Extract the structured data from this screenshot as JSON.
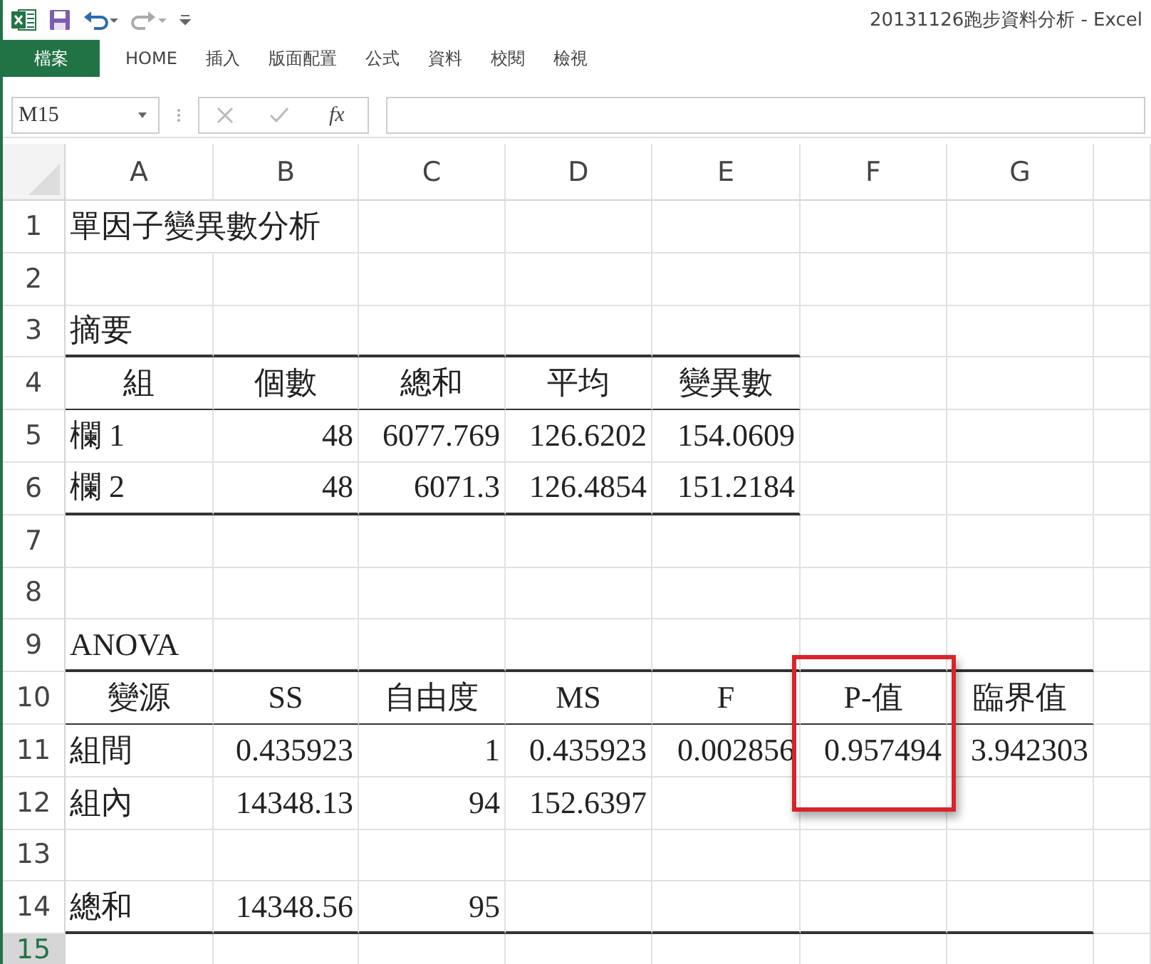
{
  "window": {
    "title": "20131126跑步資料分析 - Excel"
  },
  "ribbon_tabs": [
    {
      "label": "檔案",
      "selected": true
    },
    {
      "label": "HOME",
      "selected": false
    },
    {
      "label": "插入",
      "selected": false
    },
    {
      "label": "版面配置",
      "selected": false
    },
    {
      "label": "公式",
      "selected": false
    },
    {
      "label": "資料",
      "selected": false
    },
    {
      "label": "校閱",
      "selected": false
    },
    {
      "label": "檢視",
      "selected": false
    }
  ],
  "formula_bar": {
    "name_box": "M15",
    "function_label": "fx"
  },
  "column_headers": [
    "A",
    "B",
    "C",
    "D",
    "E",
    "F",
    "G"
  ],
  "rows": [
    {
      "header": "1",
      "selected": false,
      "cells": [
        {
          "text": "單因子變異數分析",
          "kind": "label"
        }
      ]
    },
    {
      "header": "2",
      "selected": false,
      "cells": []
    },
    {
      "header": "3",
      "selected": false,
      "cells": [
        {
          "text": "摘要",
          "kind": "label",
          "rule_below": true,
          "heavy": true
        },
        {
          "rule_below": true,
          "heavy": true
        },
        {
          "rule_below": true,
          "heavy": true
        },
        {
          "rule_below": true,
          "heavy": true
        },
        {
          "rule_below": true,
          "heavy": true
        }
      ]
    },
    {
      "header": "4",
      "selected": false,
      "cells": [
        {
          "text": "組",
          "kind": "heading",
          "rule_below": true,
          "heavy": false
        },
        {
          "text": "個數",
          "kind": "heading",
          "rule_below": true,
          "heavy": false
        },
        {
          "text": "總和",
          "kind": "heading",
          "rule_below": true,
          "heavy": false
        },
        {
          "text": "平均",
          "kind": "heading",
          "rule_below": true,
          "heavy": false
        },
        {
          "text": "變異數",
          "kind": "heading",
          "rule_below": true,
          "heavy": false
        }
      ]
    },
    {
      "header": "5",
      "selected": false,
      "cells": [
        {
          "text": "欄 1",
          "kind": "label"
        },
        {
          "text": "48",
          "kind": "number"
        },
        {
          "text": "6077.769",
          "kind": "number"
        },
        {
          "text": "126.6202",
          "kind": "number"
        },
        {
          "text": "154.0609",
          "kind": "number"
        }
      ]
    },
    {
      "header": "6",
      "selected": false,
      "cells": [
        {
          "text": "欄 2",
          "kind": "label",
          "rule_below": true,
          "heavy": true
        },
        {
          "text": "48",
          "kind": "number",
          "rule_below": true,
          "heavy": true
        },
        {
          "text": "6071.3",
          "kind": "number",
          "rule_below": true,
          "heavy": true
        },
        {
          "text": "126.4854",
          "kind": "number",
          "rule_below": true,
          "heavy": true
        },
        {
          "text": "151.2184",
          "kind": "number",
          "rule_below": true,
          "heavy": true
        }
      ]
    },
    {
      "header": "7",
      "selected": false,
      "cells": []
    },
    {
      "header": "8",
      "selected": false,
      "cells": []
    },
    {
      "header": "9",
      "selected": false,
      "cells": [
        {
          "text": "ANOVA",
          "kind": "label",
          "rule_below": true,
          "heavy": true
        },
        {
          "rule_below": true,
          "heavy": true
        },
        {
          "rule_below": true,
          "heavy": true
        },
        {
          "rule_below": true,
          "heavy": true
        },
        {
          "rule_below": true,
          "heavy": true
        },
        {
          "rule_below": true,
          "heavy": true
        },
        {
          "rule_below": true,
          "heavy": true
        }
      ]
    },
    {
      "header": "10",
      "selected": false,
      "cells": [
        {
          "text": "變源",
          "kind": "heading",
          "rule_below": true,
          "heavy": false
        },
        {
          "text": "SS",
          "kind": "heading",
          "rule_below": true,
          "heavy": false
        },
        {
          "text": "自由度",
          "kind": "heading",
          "rule_below": true,
          "heavy": false
        },
        {
          "text": "MS",
          "kind": "heading",
          "rule_below": true,
          "heavy": false
        },
        {
          "text": "F",
          "kind": "heading",
          "rule_below": true,
          "heavy": false
        },
        {
          "text": "P-值",
          "kind": "heading",
          "rule_below": true,
          "heavy": false,
          "callout": true
        },
        {
          "text": "臨界值",
          "kind": "heading",
          "rule_below": true,
          "heavy": false
        }
      ]
    },
    {
      "header": "11",
      "selected": false,
      "cells": [
        {
          "text": "組間",
          "kind": "label"
        },
        {
          "text": "0.435923",
          "kind": "number"
        },
        {
          "text": "1",
          "kind": "number"
        },
        {
          "text": "0.435923",
          "kind": "number"
        },
        {
          "text": "0.002856",
          "kind": "number"
        },
        {
          "text": "0.957494",
          "kind": "number",
          "callout": true
        },
        {
          "text": "3.942303",
          "kind": "number"
        }
      ]
    },
    {
      "header": "12",
      "selected": false,
      "cells": [
        {
          "text": "組內",
          "kind": "label"
        },
        {
          "text": "14348.13",
          "kind": "number"
        },
        {
          "text": "94",
          "kind": "number"
        },
        {
          "text": "152.6397",
          "kind": "number"
        }
      ]
    },
    {
      "header": "13",
      "selected": false,
      "cells": []
    },
    {
      "header": "14",
      "selected": false,
      "cells": [
        {
          "text": "總和",
          "kind": "label",
          "rule_below": true,
          "heavy": true
        },
        {
          "text": "14348.56",
          "kind": "number",
          "rule_below": true,
          "heavy": true
        },
        {
          "text": "95",
          "kind": "number",
          "rule_below": true,
          "heavy": true
        },
        {
          "rule_below": true,
          "heavy": true
        },
        {
          "rule_below": true,
          "heavy": true
        },
        {
          "rule_below": true,
          "heavy": true
        },
        {
          "rule_below": true,
          "heavy": true
        }
      ]
    },
    {
      "header": "15",
      "selected": true,
      "cells": []
    }
  ]
}
